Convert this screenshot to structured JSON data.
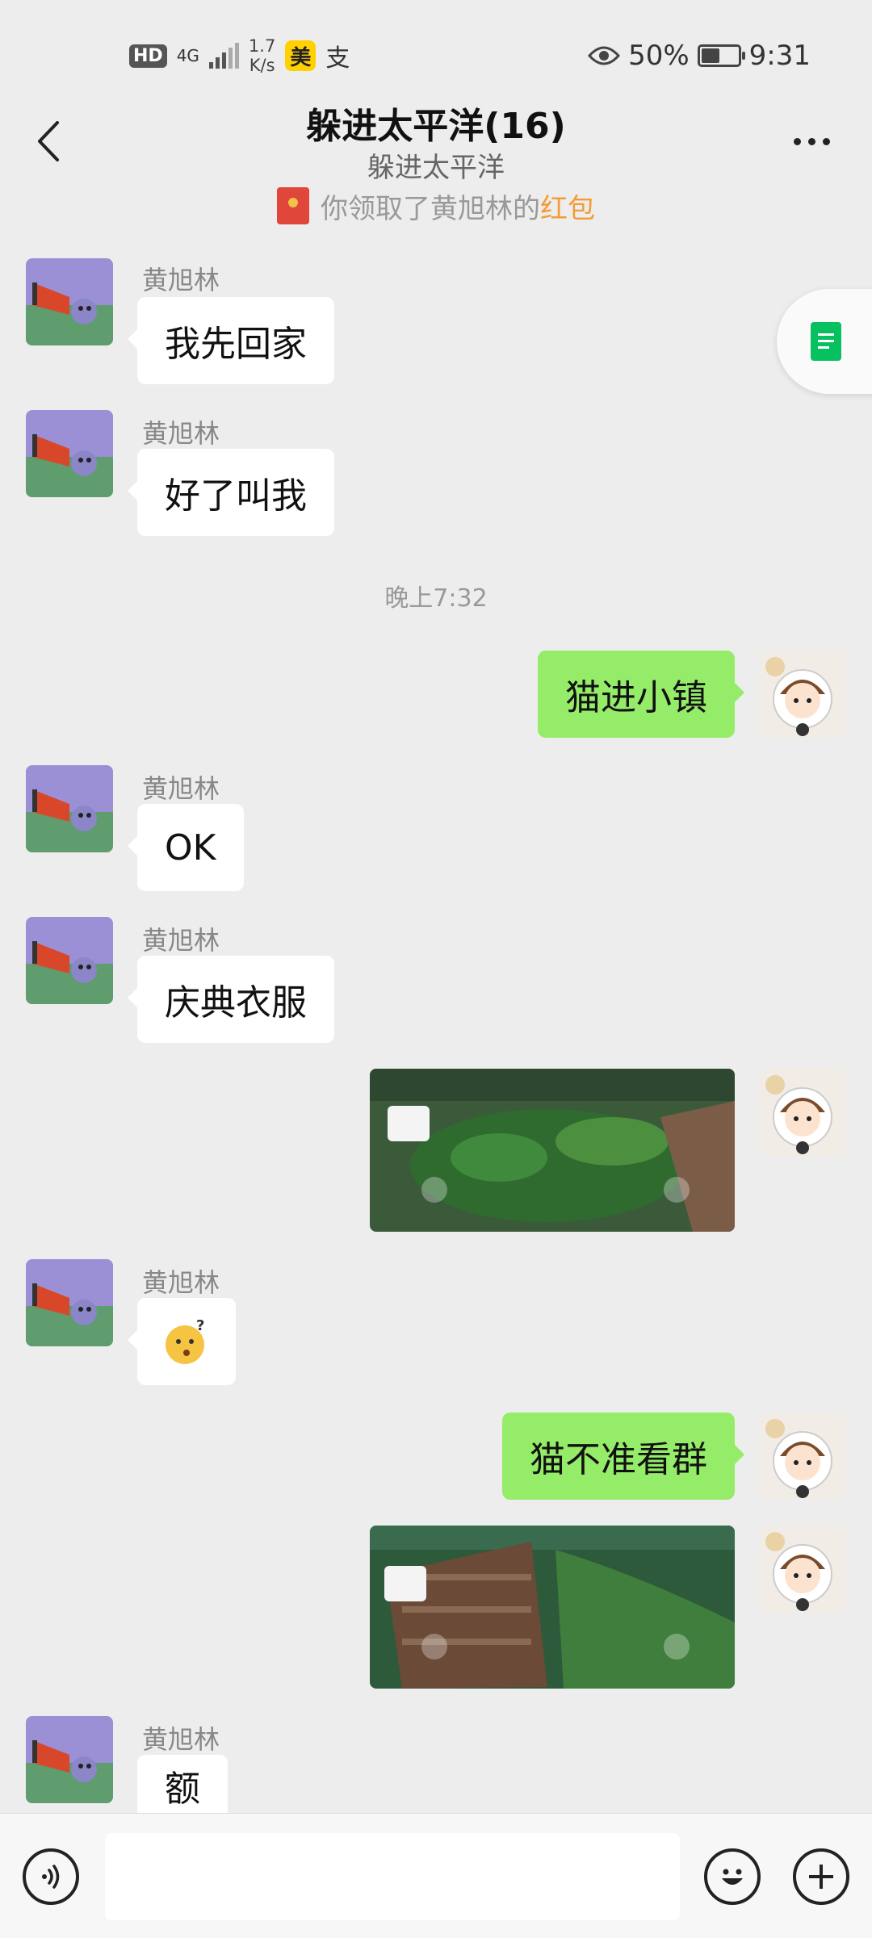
{
  "status_bar": {
    "hd": "HD",
    "network": "4G",
    "speed_value": "1.7",
    "speed_unit": "K/s",
    "app_badge_meituan": "美",
    "app_badge_alipay": "支",
    "battery_percent": "50%",
    "battery_level": 0.5,
    "time": "9:31"
  },
  "header": {
    "title": "躲进太平洋(16)",
    "subtitle": "躲进太平洋"
  },
  "system_note": {
    "prefix": "你领取了黄旭林的",
    "link": "红包"
  },
  "messages": [
    {
      "sender": "黄旭林",
      "text": "我先回家"
    },
    {
      "sender": "黄旭林",
      "text": "好了叫我"
    },
    {
      "timestamp": "晚上7:32"
    },
    {
      "self": true,
      "text": "猫进小镇"
    },
    {
      "sender": "黄旭林",
      "text": "OK"
    },
    {
      "sender": "黄旭林",
      "text": "庆典衣服"
    },
    {
      "self": true,
      "image": "game-screenshot"
    },
    {
      "sender": "黄旭林",
      "emoji": "confused-face-emoji"
    },
    {
      "self": true,
      "text": "猫不准看群"
    },
    {
      "self": true,
      "image": "game-screenshot"
    },
    {
      "sender": "黄旭林",
      "text": "额"
    }
  ],
  "colors": {
    "self_bubble": "#95ec69",
    "other_bubble": "#ffffff",
    "background": "#ededed",
    "red_packet_link": "#f39c37",
    "side_doc_icon": "#07c160"
  },
  "icons": {
    "back": "chevron-left-icon",
    "more": "more-dots-icon",
    "voice": "voice-icon",
    "emoji": "emoji-icon",
    "plus": "plus-icon",
    "document": "document-icon"
  },
  "input": {
    "value": ""
  }
}
